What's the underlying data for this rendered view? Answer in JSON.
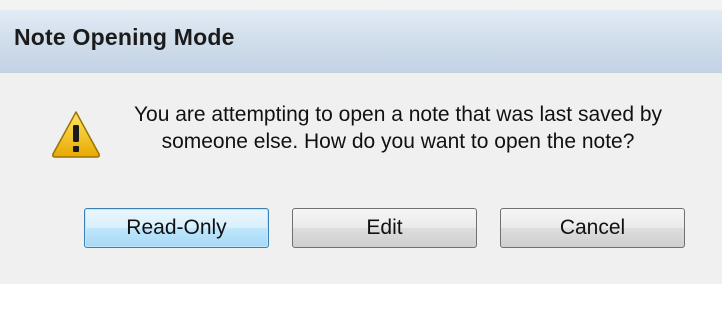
{
  "dialog": {
    "title": "Note Opening Mode",
    "message_line1": "You are attempting to open a note that was last saved by",
    "message_line2": "someone else.  How do you want to open the note?",
    "icon": "warning-icon",
    "buttons": {
      "read_only": "Read-Only",
      "edit": "Edit",
      "cancel": "Cancel"
    },
    "default_button": "read_only"
  },
  "colors": {
    "titlebar": "#cfdcea",
    "body": "#f0f0f0",
    "default_button_border": "#3c7fb1",
    "warning_fill": "#f5c400"
  }
}
